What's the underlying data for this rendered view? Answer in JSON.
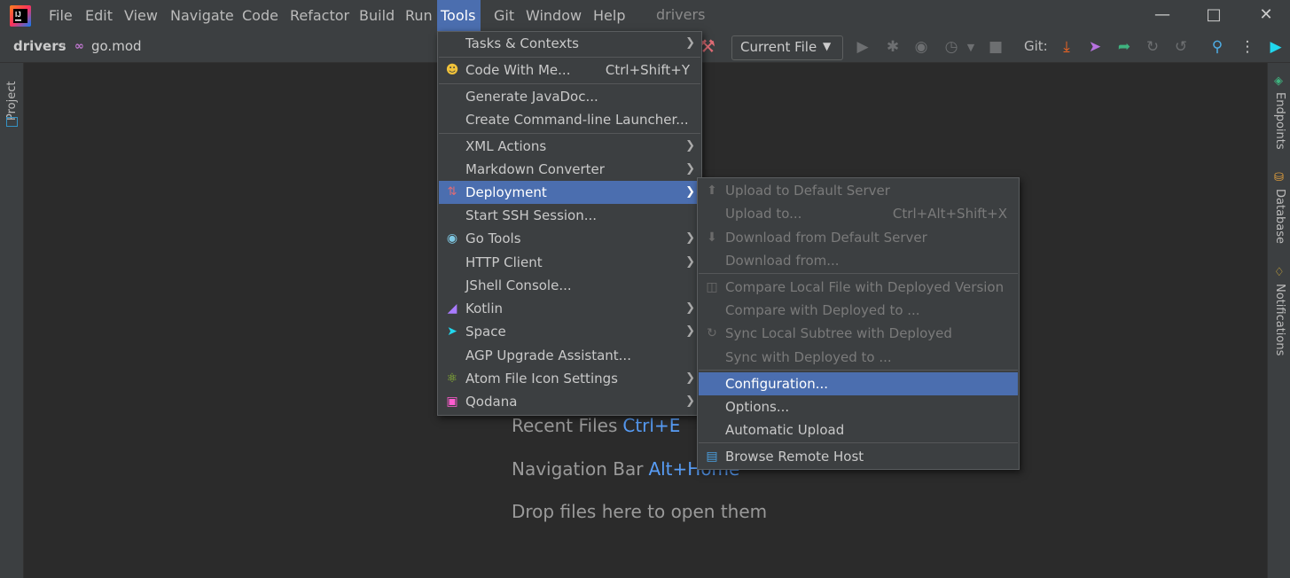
{
  "menubar": {
    "items": [
      "File",
      "Edit",
      "View",
      "Navigate",
      "Code",
      "Refactor",
      "Build",
      "Run",
      "Tools",
      "Git",
      "Window",
      "Help"
    ],
    "window_title": "drivers"
  },
  "navbar": {
    "project": "drivers",
    "separator": "›",
    "file": "go.mod",
    "run_config": "Current File",
    "git_label": "Git:"
  },
  "side_tabs": {
    "left": "Project",
    "right": [
      "Endpoints",
      "Database",
      "Notifications"
    ]
  },
  "editor_hints": [
    {
      "label": "Recent Files",
      "key": "Ctrl+E"
    },
    {
      "label": "Navigation Bar",
      "key": "Alt+Home"
    },
    {
      "label": "Drop files here to open them",
      "key": ""
    }
  ],
  "tools_menu": {
    "items": [
      {
        "label": "Tasks & Contexts",
        "shortcut": "",
        "submenu": true,
        "icon": ""
      },
      {
        "label": "Code With Me...",
        "shortcut": "Ctrl+Shift+Y",
        "submenu": false,
        "icon": "users-icon"
      },
      {
        "label": "Generate JavaDoc...",
        "shortcut": "",
        "submenu": false,
        "icon": ""
      },
      {
        "label": "Create Command-line Launcher...",
        "shortcut": "",
        "submenu": false,
        "icon": ""
      },
      {
        "label": "XML Actions",
        "shortcut": "",
        "submenu": true,
        "icon": ""
      },
      {
        "label": "Markdown Converter",
        "shortcut": "",
        "submenu": true,
        "icon": ""
      },
      {
        "label": "Deployment",
        "shortcut": "",
        "submenu": true,
        "icon": "deployment-icon",
        "selected": true
      },
      {
        "label": "Start SSH Session...",
        "shortcut": "",
        "submenu": false,
        "icon": ""
      },
      {
        "label": "Go Tools",
        "shortcut": "",
        "submenu": true,
        "icon": "gopher-icon"
      },
      {
        "label": "HTTP Client",
        "shortcut": "",
        "submenu": true,
        "icon": ""
      },
      {
        "label": "JShell Console...",
        "shortcut": "",
        "submenu": false,
        "icon": ""
      },
      {
        "label": "Kotlin",
        "shortcut": "",
        "submenu": true,
        "icon": "kotlin-icon"
      },
      {
        "label": "Space",
        "shortcut": "",
        "submenu": true,
        "icon": "space-icon"
      },
      {
        "label": "AGP Upgrade Assistant...",
        "shortcut": "",
        "submenu": false,
        "icon": ""
      },
      {
        "label": "Atom File Icon Settings",
        "shortcut": "",
        "submenu": true,
        "icon": "atom-icon"
      },
      {
        "label": "Qodana",
        "shortcut": "",
        "submenu": true,
        "icon": "qodana-icon"
      }
    ]
  },
  "deployment_menu": {
    "items": [
      {
        "label": "Upload to Default Server",
        "shortcut": "",
        "enabled": false,
        "icon": "upload-icon"
      },
      {
        "label": "Upload to...",
        "shortcut": "Ctrl+Alt+Shift+X",
        "enabled": false,
        "icon": ""
      },
      {
        "label": "Download from Default Server",
        "shortcut": "",
        "enabled": false,
        "icon": "download-icon"
      },
      {
        "label": "Download from...",
        "shortcut": "",
        "enabled": false,
        "icon": ""
      },
      {
        "label": "Compare Local File with Deployed Version",
        "shortcut": "",
        "enabled": false,
        "icon": "compare-icon"
      },
      {
        "label": "Compare with Deployed to ...",
        "shortcut": "",
        "enabled": false,
        "icon": ""
      },
      {
        "label": "Sync Local Subtree with Deployed",
        "shortcut": "",
        "enabled": false,
        "icon": "sync-icon"
      },
      {
        "label": "Sync with Deployed to ...",
        "shortcut": "",
        "enabled": false,
        "icon": ""
      },
      {
        "label": "Configuration...",
        "shortcut": "",
        "enabled": true,
        "icon": "",
        "selected": true
      },
      {
        "label": "Options...",
        "shortcut": "",
        "enabled": true,
        "icon": ""
      },
      {
        "label": "Automatic Upload",
        "shortcut": "",
        "enabled": true,
        "icon": ""
      },
      {
        "label": "Browse Remote Host",
        "shortcut": "",
        "enabled": true,
        "icon": "remote-host-icon"
      }
    ]
  },
  "colors": {
    "accent": "#4b6eaf",
    "background": "#2b2b2b",
    "panel": "#3c3f41",
    "shortcut_blue": "#589df6"
  }
}
